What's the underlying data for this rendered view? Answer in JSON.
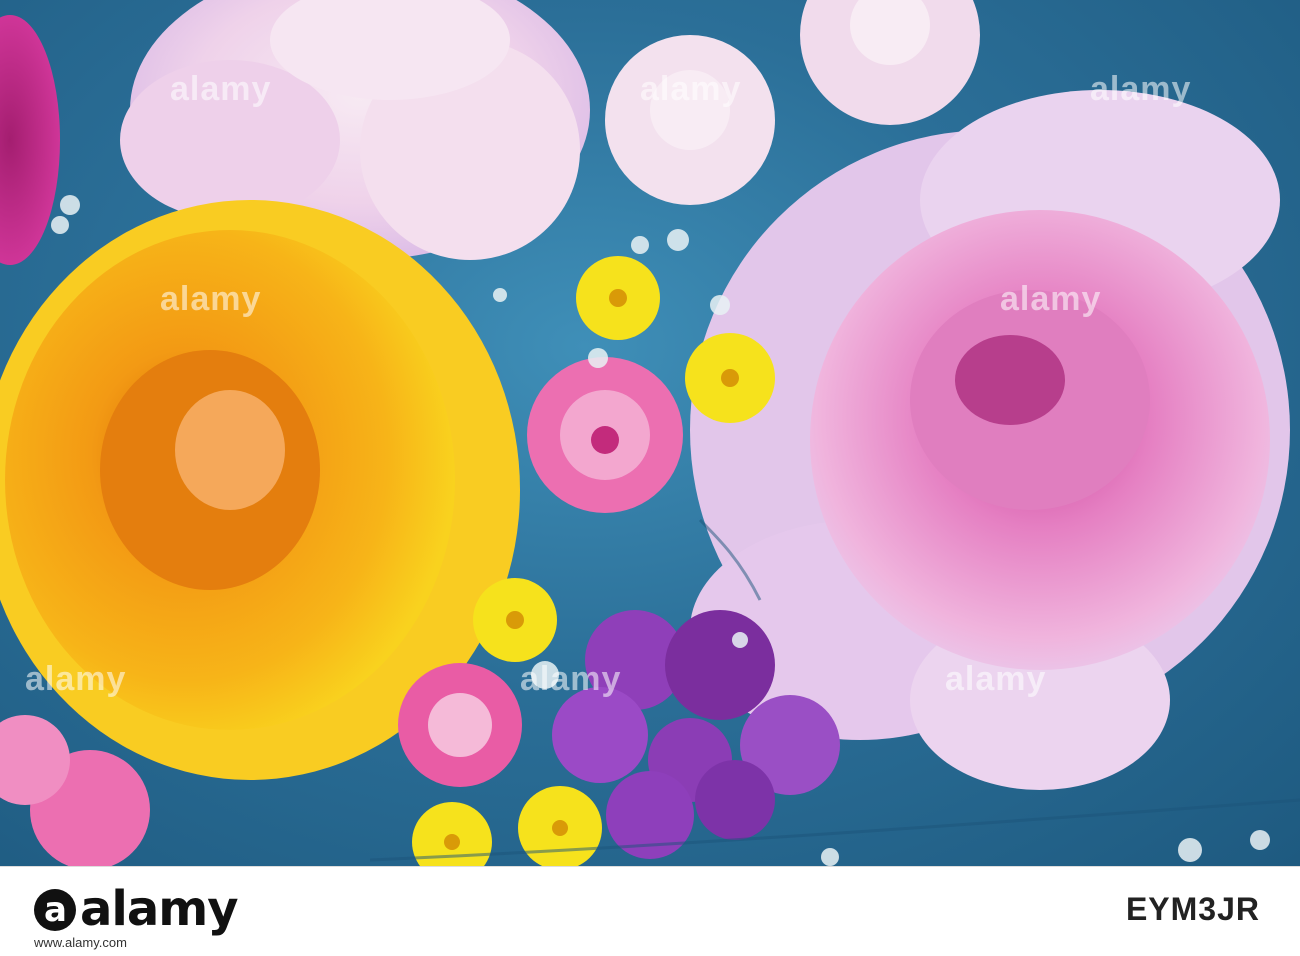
{
  "image": {
    "description_colors": {
      "water": "#2b6f98",
      "orange_rose": "#f59a12",
      "pink_peony": "#e97fc0",
      "pale_peony": "#f2d6ec",
      "yellow_flower": "#f6e21c",
      "purple_flower": "#8a3fb8",
      "magenta_flower": "#e0479a"
    }
  },
  "watermarks": [
    "alamy",
    "alamy",
    "alamy",
    "alamy",
    "alamy",
    "alamy",
    "alamy",
    "alamy"
  ],
  "footer": {
    "logo_text": "alamy",
    "stock_id": "EYM3JR",
    "site_url": "www.alamy.com"
  }
}
